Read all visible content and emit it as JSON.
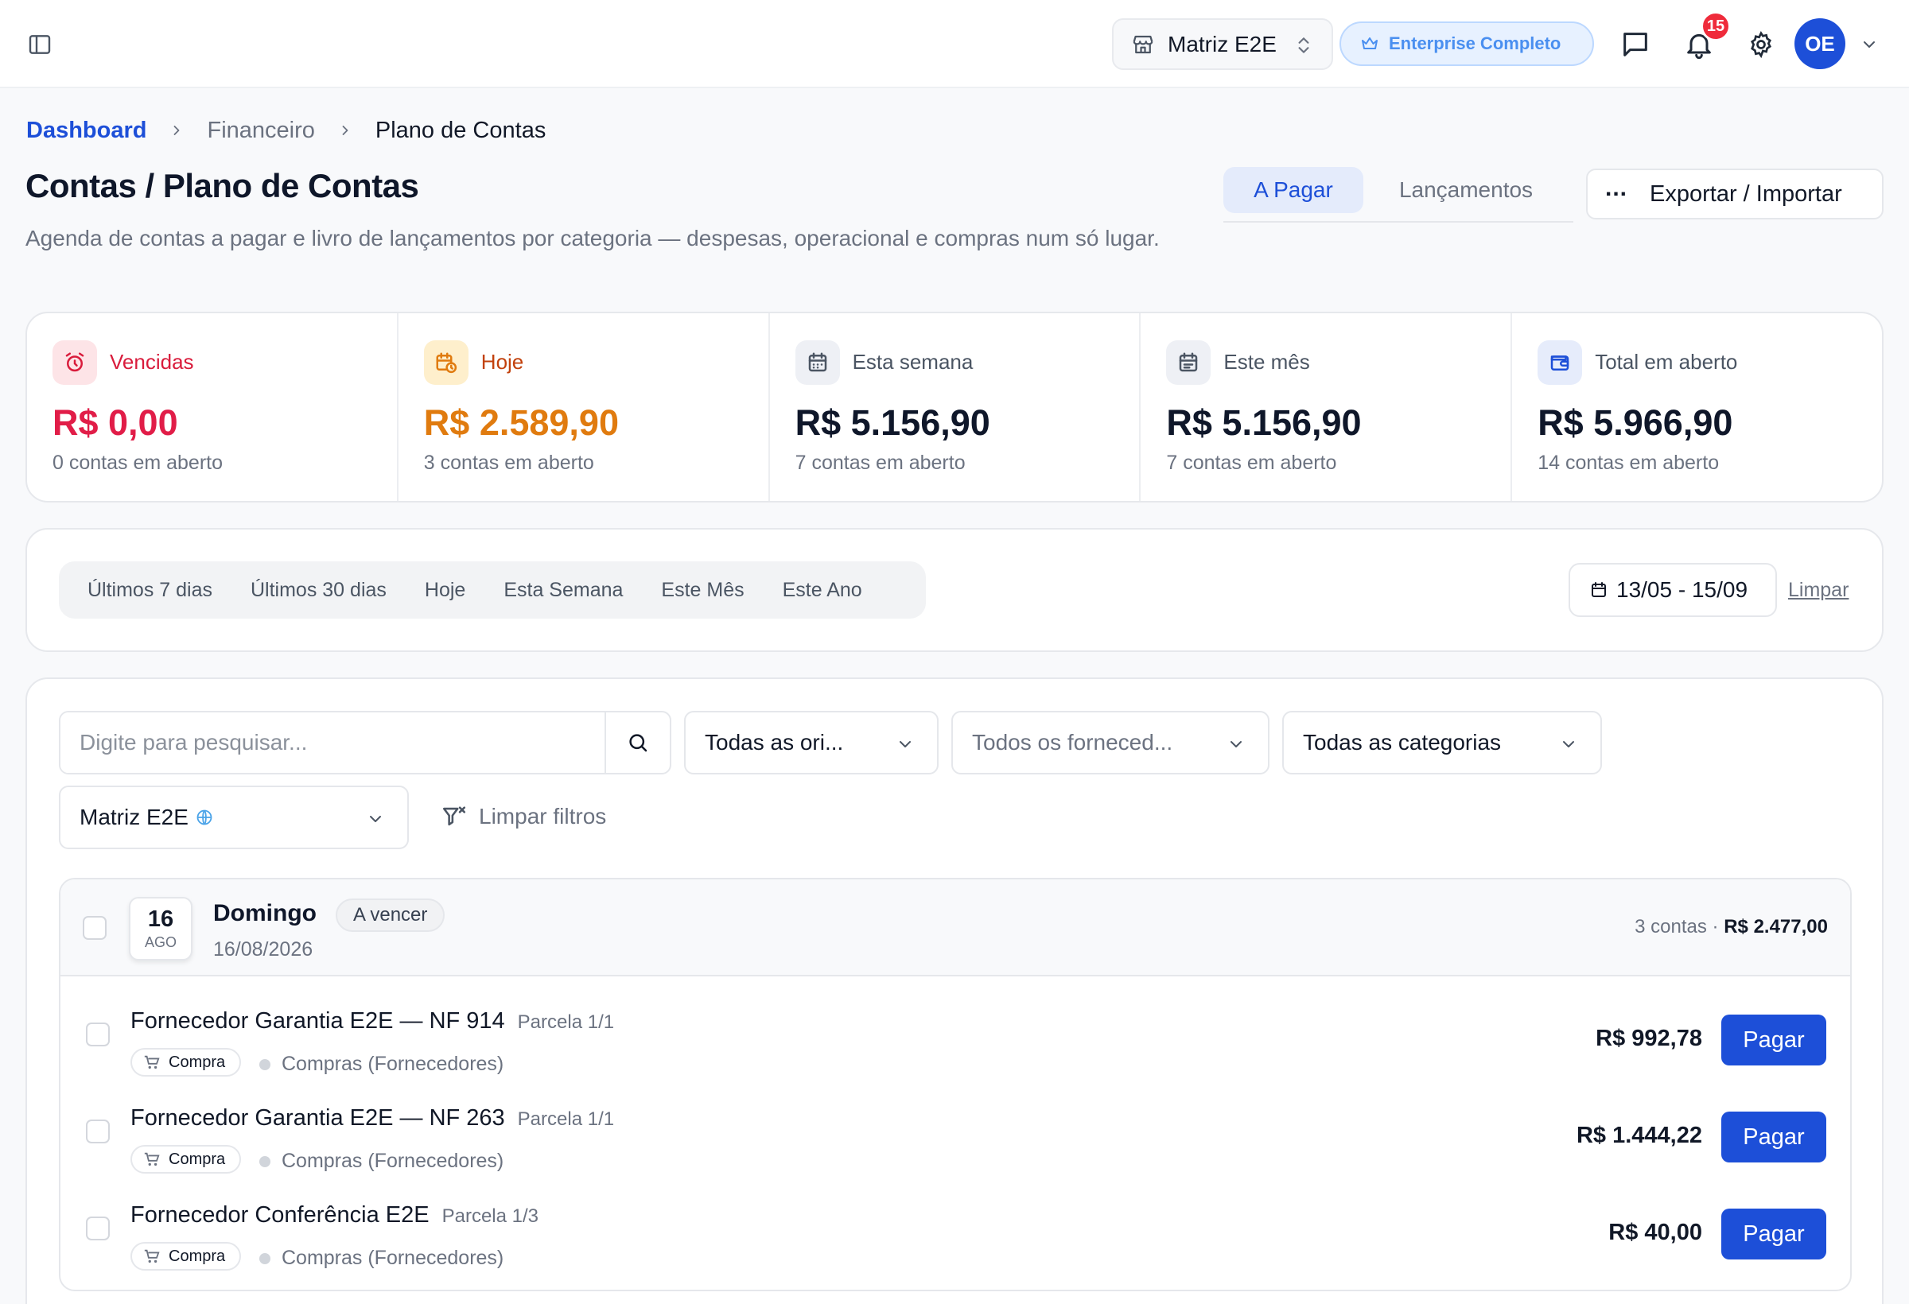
{
  "topbar": {
    "store": "Matriz E2E",
    "plan": "Enterprise Completo",
    "notifications_count": "15",
    "avatar_initials": "OE"
  },
  "breadcrumb": {
    "home": "Dashboard",
    "section": "Financeiro",
    "current": "Plano de Contas"
  },
  "header": {
    "title": "Contas / Plano de Contas",
    "subtitle": "Agenda de contas a pagar e livro de lançamentos por categoria — despesas, operacional e compras num só lugar.",
    "tabs": [
      {
        "label": "A Pagar",
        "active": true
      },
      {
        "label": "Lançamentos",
        "active": false
      }
    ],
    "export_label": "Exportar / Importar"
  },
  "stats": [
    {
      "label": "Vencidas",
      "value": "R$ 0,00",
      "caption": "0 contas em aberto",
      "accent": "#d91c3c",
      "icon": "alarm-clock-icon"
    },
    {
      "label": "Hoje",
      "value": "R$ 2.589,90",
      "caption": "3 contas em aberto",
      "accent": "#e07b0f",
      "icon": "calendar-clock-icon"
    },
    {
      "label": "Esta semana",
      "value": "R$ 5.156,90",
      "caption": "7 contas em aberto",
      "accent": "#0f172a",
      "icon": "calendar-icon"
    },
    {
      "label": "Este mês",
      "value": "R$ 5.156,90",
      "caption": "7 contas em aberto",
      "accent": "#0f172a",
      "icon": "calendar-icon"
    },
    {
      "label": "Total em aberto",
      "value": "R$ 5.966,90",
      "caption": "14 contas em aberto",
      "accent": "#0f172a",
      "icon": "wallet-icon"
    }
  ],
  "period": {
    "options": [
      "Últimos 7 dias",
      "Últimos 30 dias",
      "Hoje",
      "Esta Semana",
      "Este Mês",
      "Este Ano"
    ],
    "range": "13/05 - 15/09",
    "clear": "Limpar"
  },
  "filters": {
    "search_placeholder": "Digite para pesquisar...",
    "origin": "Todas as ori...",
    "supplier": "Todos os forneced...",
    "category": "Todas as categorias",
    "store": "Matriz E2E",
    "clear_filters": "Limpar filtros"
  },
  "day_group": {
    "day": "16",
    "month": "AGO",
    "weekday": "Domingo",
    "status": "A vencer",
    "date": "16/08/2026",
    "count_text": "3 contas · ",
    "total": "R$ 2.477,00"
  },
  "rows": [
    {
      "title": "Fornecedor Garantia E2E — NF 914",
      "installment": "Parcela 1/1",
      "tag": "Compra",
      "category": "Compras (Fornecedores)",
      "amount": "R$ 992,78",
      "action": "Pagar"
    },
    {
      "title": "Fornecedor Garantia E2E — NF 263",
      "installment": "Parcela 1/1",
      "tag": "Compra",
      "category": "Compras (Fornecedores)",
      "amount": "R$ 1.444,22",
      "action": "Pagar"
    },
    {
      "title": "Fornecedor Conferência E2E",
      "installment": "Parcela 1/3",
      "tag": "Compra",
      "category": "Compras (Fornecedores)",
      "amount": "R$ 40,00",
      "action": "Pagar"
    }
  ],
  "colors": {
    "primary": "#1d4fd8",
    "danger": "#d91c3c",
    "warning": "#e07b0f",
    "badge": "#ef2b3b"
  }
}
